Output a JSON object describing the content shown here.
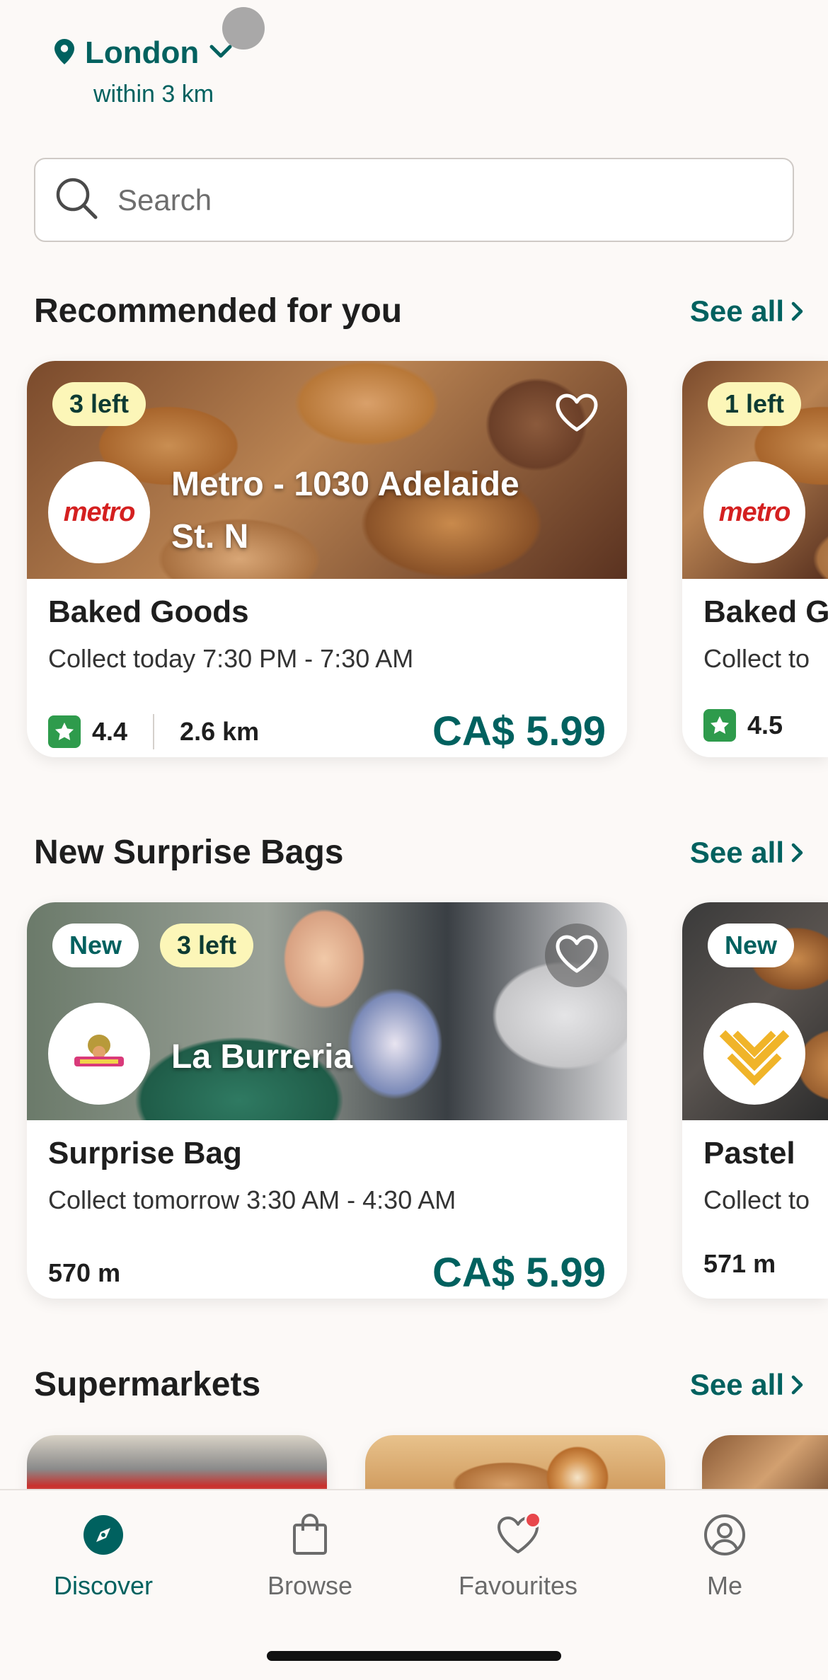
{
  "header": {
    "city": "London",
    "radius": "within 3 km"
  },
  "search": {
    "placeholder": "Search"
  },
  "sections": {
    "recommended": {
      "title": "Recommended for you",
      "see_all": "See all"
    },
    "new_bags": {
      "title": "New Surprise Bags",
      "see_all": "See all"
    },
    "supermarkets": {
      "title": "Supermarkets",
      "see_all": "See all"
    }
  },
  "recommended_cards": [
    {
      "badge": "3 left",
      "store": "Metro - 1030 Adelaide St. N",
      "logo_text": "metro",
      "title": "Baked Goods",
      "collect": "Collect today 7:30 PM - 7:30 AM",
      "rating": "4.4",
      "distance": "2.6 km",
      "price": "CA$ 5.99"
    },
    {
      "badge": "1 left",
      "logo_text": "metro",
      "title": "Baked G",
      "collect": "Collect to",
      "rating": "4.5"
    }
  ],
  "new_cards": [
    {
      "badge_new": "New",
      "badge_left": "3 left",
      "store": "La Burreria",
      "title": "Surprise Bag",
      "collect": "Collect tomorrow 3:30 AM - 4:30 AM",
      "distance": "570 m",
      "price": "CA$ 5.99"
    },
    {
      "badge_new": "New",
      "title": "Pastel",
      "collect": "Collect to",
      "distance": "571 m"
    }
  ],
  "nav": {
    "discover": "Discover",
    "browse": "Browse",
    "favourites": "Favourites",
    "me": "Me"
  },
  "colors": {
    "brand_green": "#00615f",
    "badge_yellow": "#fcf6b8",
    "rating_green": "#2e9b4c",
    "notification_red": "#e8474c"
  }
}
